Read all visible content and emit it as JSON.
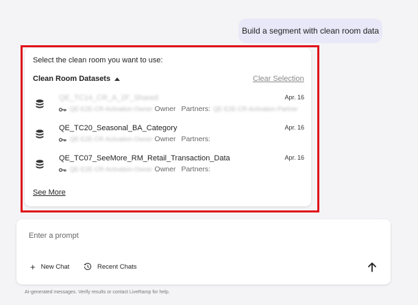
{
  "user_message": "Build a segment with clean room data",
  "prompt_title": "Select the clean room you want to use:",
  "datasets_header": "Clean Room Datasets",
  "clear_selection": "Clear Selection",
  "rows": [
    {
      "name": "QE_TC14_CR_A_2F_Shared",
      "date": "Apr. 16",
      "owner_name": "QE-E2E-CR-Activation-Owner",
      "owner_label": "Owner",
      "partners_label": "Partners:",
      "partners_value": "QE-E2E-CR-Activation-Partner",
      "name_blurred": true
    },
    {
      "name": "QE_TC20_Seasonal_BA_Category",
      "date": "Apr. 16",
      "owner_name": "QE-E2E-CR-Activation-Owner",
      "owner_label": "Owner",
      "partners_label": "Partners:",
      "partners_value": "",
      "name_blurred": false
    },
    {
      "name": "QE_TC07_SeeMore_RM_Retail_Transaction_Data",
      "date": "Apr. 16",
      "owner_name": "QE-E2E-CR-Activation-Owner",
      "owner_label": "Owner",
      "partners_label": "Partners:",
      "partners_value": "",
      "name_blurred": false
    }
  ],
  "see_more": "See More",
  "input_placeholder": "Enter a prompt",
  "new_chat": "New Chat",
  "recent_chats": "Recent Chats",
  "footer_note": "AI-generated messages. Verify results or contact LiveRamp for help.",
  "icons": {
    "dataset": "database-icon",
    "key": "key-icon",
    "new_chat": "plus-icon",
    "recent": "history-icon",
    "send": "arrow-up-icon"
  },
  "colors": {
    "highlight": "#e0101a",
    "user_bubble": "#e9e8f8",
    "background": "#f4f4f6"
  }
}
